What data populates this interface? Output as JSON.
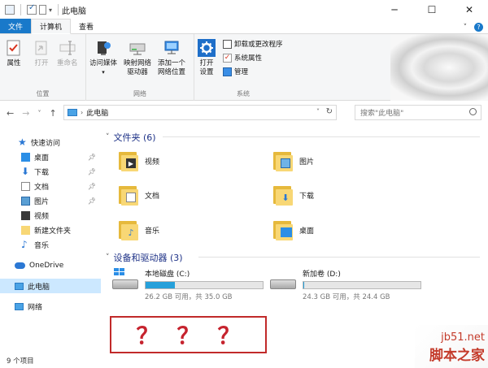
{
  "window": {
    "title": "此电脑",
    "controls": [
      "─",
      "☐",
      "✕"
    ]
  },
  "ribbon": {
    "tabs": {
      "file": "文件",
      "computer": "计算机",
      "view": "查看"
    },
    "help_chevron": "˅",
    "help": "?",
    "groups": {
      "location": {
        "label": "位置",
        "properties": "属性",
        "open": "打开",
        "rename": "重命名"
      },
      "network": {
        "label": "网络",
        "access_media": "访问媒体",
        "map_drive_1": "映射网络",
        "map_drive_2": "驱动器",
        "add_location_1": "添加一个",
        "add_location_2": "网络位置"
      },
      "system": {
        "label": "系统",
        "open_settings_1": "打开",
        "open_settings_2": "设置",
        "uninstall": "卸载或更改程序",
        "system_properties": "系统属性",
        "manage": "管理"
      }
    }
  },
  "address": {
    "location": "此电脑",
    "search_placeholder": "搜索\"此电脑\""
  },
  "sidebar": {
    "quick_access": "快速访问",
    "items": [
      {
        "label": "桌面",
        "pinned": true
      },
      {
        "label": "下载",
        "pinned": true
      },
      {
        "label": "文档",
        "pinned": true
      },
      {
        "label": "图片",
        "pinned": true
      },
      {
        "label": "视频",
        "pinned": false
      },
      {
        "label": "新建文件夹",
        "pinned": false
      },
      {
        "label": "音乐",
        "pinned": false
      }
    ],
    "onedrive": "OneDrive",
    "this_pc": "此电脑",
    "network": "网络"
  },
  "status": "9 个项目",
  "folders_section": {
    "title": "文件夹 (6)",
    "items": [
      "视频",
      "图片",
      "文档",
      "下载",
      "音乐",
      "桌面"
    ]
  },
  "drives_section": {
    "title": "设备和驱动器 (3)",
    "drives": [
      {
        "name": "本地磁盘 (C:)",
        "free": "26.2 GB 可用，共 35.0 GB",
        "used_fraction": 0.25
      },
      {
        "name": "新加卷 (D:)",
        "free": "24.3 GB 可用，共 24.4 GB",
        "used_fraction": 0.005
      }
    ]
  },
  "annotation": {
    "marks": [
      "？",
      "？",
      "？"
    ],
    "color": "#c6232e"
  },
  "watermark": {
    "line1": "jb51.net",
    "line2": "脚本之家"
  },
  "colors": {
    "accent": "#1979ca",
    "selection": "#cce8ff",
    "folder": "#f8d775",
    "drive_bar": "#26a0da"
  }
}
